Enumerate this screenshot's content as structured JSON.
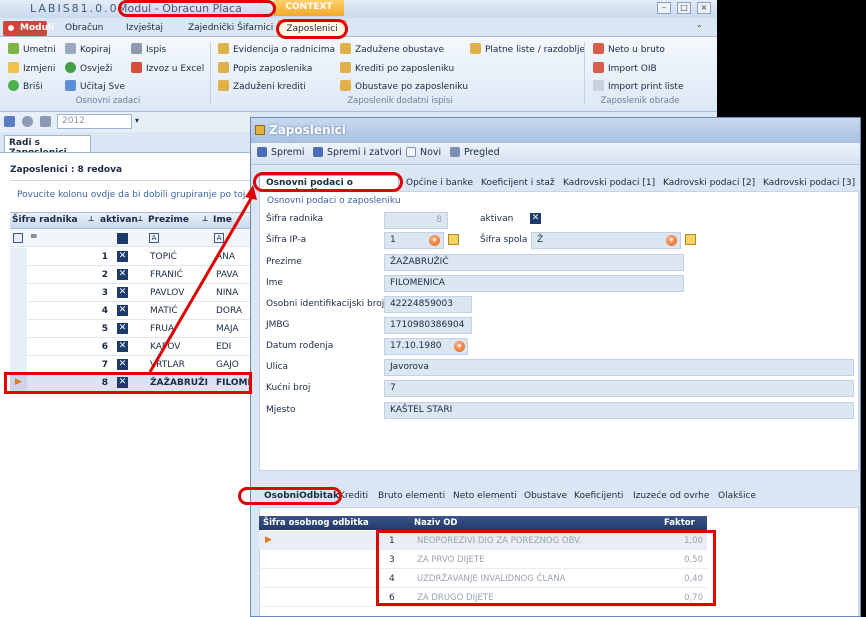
{
  "app": {
    "name": "LABIS81.0.0.",
    "module_title": "Modul - Obracun Placa",
    "context_label": "CONTEXT",
    "window_controls": [
      "–",
      "□",
      "×"
    ]
  },
  "top_tabs": {
    "moduli": "Moduli",
    "items": [
      "Obračun",
      "Izvještaj",
      "Zajednički Šifarnici"
    ],
    "active": "Zaposlenici"
  },
  "ribbon": {
    "group1": {
      "label": "Osnovni zadaci",
      "col1": [
        "Umetni",
        "Izmjeni",
        "Briši"
      ],
      "col2": [
        "Kopiraj",
        "Osvježi",
        "Učitaj Sve"
      ],
      "col3": [
        "Ispis",
        "Izvoz u Excel"
      ]
    },
    "group2": {
      "label": "Zaposlenik dodatni ispisi",
      "col1": [
        "Evidencija o radnicima",
        "Popis zaposlenika",
        "Zaduženi krediti"
      ],
      "col2": [
        "Zadužene obustave",
        "Krediti po zaposleniku",
        "Obustave po zaposleniku"
      ],
      "col3": [
        "Platne liste / razdoblje"
      ]
    },
    "group3": {
      "label": "Zaposlenik obrade",
      "col1": [
        "Neto u bruto",
        "Import OIB",
        "Import print liste"
      ]
    }
  },
  "toolstrip": {
    "year": "2012"
  },
  "left": {
    "tab": "Radi s Zaposlenici",
    "count": "Zaposlenici : 8 redova",
    "group_hint": "Povucite kolonu ovdje da bi dobili grupiranje po toj",
    "columns": [
      "Šifra radnika",
      "aktivan",
      "Prezime",
      "Ime"
    ],
    "rows": [
      {
        "num": "1",
        "prezime": "TOPIĆ",
        "ime": "ANA"
      },
      {
        "num": "2",
        "prezime": "FRANIĆ",
        "ime": "PAVA"
      },
      {
        "num": "3",
        "prezime": "PAVLOV",
        "ime": "NINA"
      },
      {
        "num": "4",
        "prezime": "MATIĆ",
        "ime": "DORA"
      },
      {
        "num": "5",
        "prezime": "FRUA",
        "ime": "MAJA"
      },
      {
        "num": "6",
        "prezime": "KAPOV",
        "ime": "EDI"
      },
      {
        "num": "7",
        "prezime": "VRTLAR",
        "ime": "GAJO"
      },
      {
        "num": "8",
        "prezime": "ŽAŽABRUŽI",
        "ime": "FILOME"
      }
    ]
  },
  "dialog": {
    "title": "Zaposlenici",
    "toolbar": [
      "Spremi",
      "Spremi i zatvori",
      "Novi",
      "Pregled"
    ],
    "tabs": [
      "Osnovni podaci o zaposleniku",
      "Općine i banke",
      "Koeficijent i staž",
      "Kadrovski podaci [1]",
      "Kadrovski podaci [2]",
      "Kadrovski podaci [3]"
    ],
    "section": "Osnovni podaci o zaposleniku",
    "fields": {
      "sifra_radnika_label": "Šifra radnika",
      "sifra_radnika": "8",
      "aktivan_label": "aktivan",
      "sifra_ip_label": "Šifra IP-a",
      "sifra_ip": "1",
      "sifra_spola_label": "Šifra spola",
      "sifra_spola": "Ž",
      "prezime_label": "Prezime",
      "prezime": "ŽAŽABRUŽIĆ",
      "ime_label": "Ime",
      "ime": "FILOMENICA",
      "oib_label": "Osobni identifikacijski broj",
      "oib": "42224859003",
      "jmbg_label": "JMBG",
      "jmbg": "1710980386904",
      "datum_label": "Datum rođenja",
      "datum": "17.10.1980",
      "ulica_label": "Ulica",
      "ulica": "Javorova",
      "kbroj_label": "Kućni broj",
      "kbroj": "7",
      "mjesto_label": "Mjesto",
      "mjesto": "KAŠTEL STARI"
    },
    "bottom_tabs": [
      "OsobniOdbitak",
      "Krediti",
      "Bruto elementi",
      "Neto elementi",
      "Obustave",
      "Koeficijenti",
      "Izuzeće od ovrhe",
      "Olakšice"
    ],
    "odbitak_columns": [
      "Šifra osobnog odbitka",
      "Naziv OD",
      "Faktor"
    ],
    "odbitak_rows": [
      {
        "sifra": "1",
        "naziv": "NEOPOREZIVI DIO ZA POREZNOG OBV.",
        "faktor": "1,00"
      },
      {
        "sifra": "3",
        "naziv": "ZA PRVO DIJETE",
        "faktor": "0,50"
      },
      {
        "sifra": "4",
        "naziv": "UZDRŽAVANJE INVALIDNOG ČLANA",
        "faktor": "0,40"
      },
      {
        "sifra": "6",
        "naziv": "ZA DRUGO DIJETE",
        "faktor": "0,70"
      }
    ]
  }
}
